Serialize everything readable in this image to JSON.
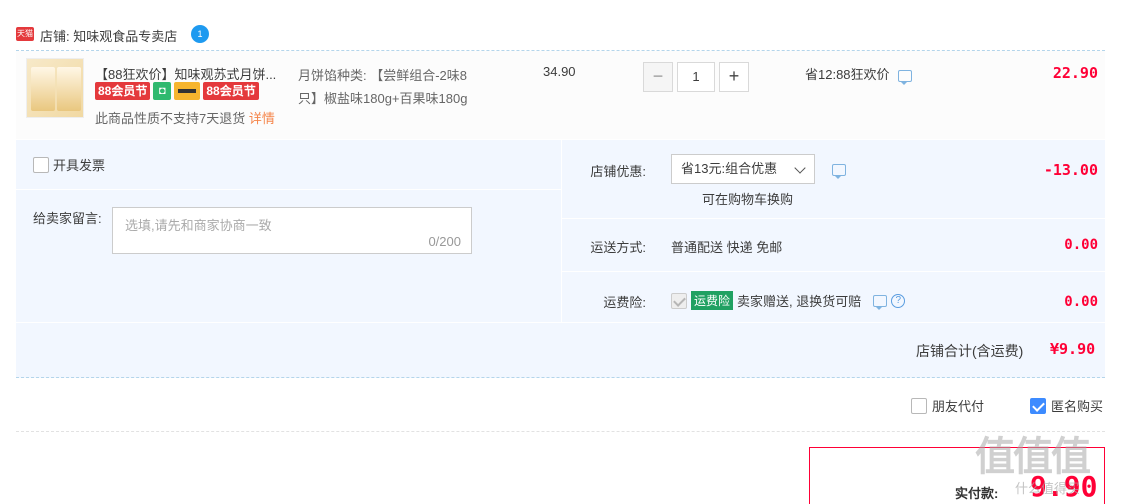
{
  "store": {
    "badge": "天猫",
    "label": "店铺: 知味观食品专卖店",
    "ww_badge": "1"
  },
  "item": {
    "title": "【88狂欢价】知味观苏式月饼...",
    "badge_a": "88会员节",
    "badge_b": "88会员节",
    "return_note": "此商品性质不支持7天退货",
    "detail_link": "详情",
    "sku_line1": "月饼馅种类: 【尝鲜组合-2味8",
    "sku_line2": "只】椒盐味180g+百果味180g",
    "price": "34.90",
    "qty": "1",
    "promo": "省12:88狂欢价",
    "total": "22.90"
  },
  "options": {
    "invoice_label": "开具发票",
    "msg_label": "给卖家留言:",
    "msg_placeholder": "选填,请先和商家协商一致",
    "msg_count": "0/200",
    "shop_discount_label": "店铺优惠:",
    "shop_discount_selected": "省13元:组合优惠",
    "shop_discount_note": "可在购物车换购",
    "shop_discount_amount": "-13.00",
    "shipping_label": "运送方式:",
    "shipping_value": "普通配送 快递 免邮",
    "shipping_amount": "0.00",
    "insurance_label": "运费险:",
    "insurance_tag": "运费险",
    "insurance_text": "卖家赠送, 退换货可赔",
    "insurance_amount": "0.00",
    "subtotal_label": "店铺合计(含运费)",
    "subtotal_value": "¥9.90"
  },
  "footer": {
    "pay_for_friend": "朋友代付",
    "anonymous": "匿名购买",
    "anonymous_checked": true,
    "actual_pay_label": "实付款:",
    "actual_pay_value": "9.90",
    "watermark": "值值值",
    "watermark_url": "什么值得买"
  }
}
